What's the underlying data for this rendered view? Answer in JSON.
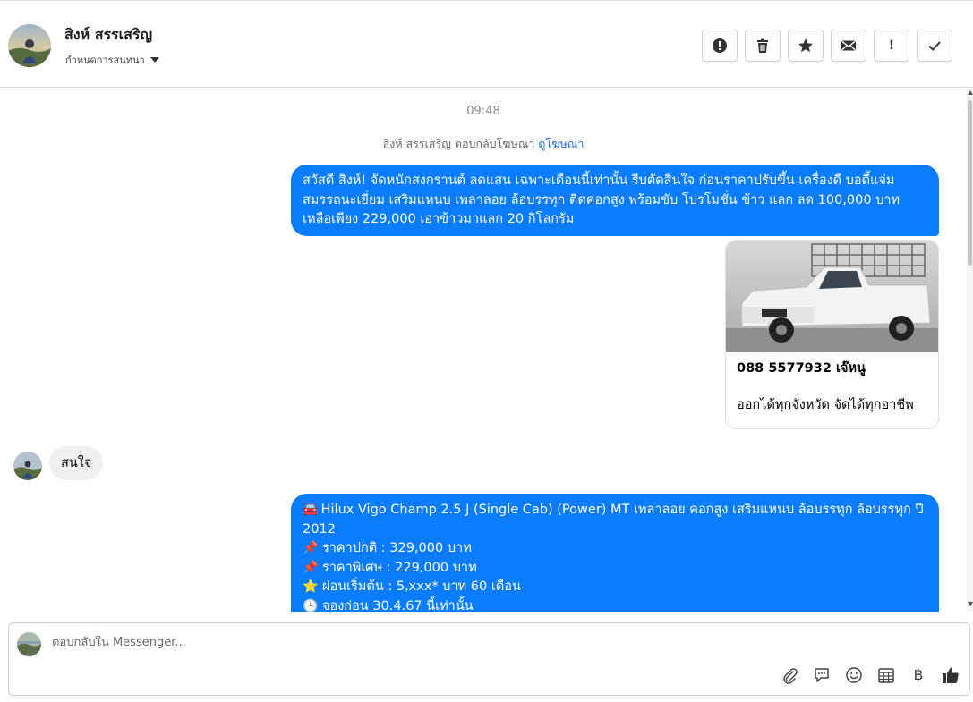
{
  "header": {
    "contact_name": "สิงห์ สรรเสริญ",
    "assign_label": "กำหนดการสนทนา",
    "actions": [
      "report-icon",
      "trash-icon",
      "star-icon",
      "envelope-icon",
      "exclamation-icon",
      "check-icon"
    ],
    "exclaim_label": "!"
  },
  "chat": {
    "timestamp": "09:48",
    "ad_reply_text": "สิงห์ สรรเสริญ ตอบกลับโฆษณา",
    "ad_reply_link": "ดูโฆษณา",
    "message1": "สวัสดี สิงห์! จัดหนักสงกรานต์ ลดแสน เฉพาะเดือนนี้เท่านั้น รีบตัดสินใจ ก่อนราคาปรับขึ้น เครื่องดี บอดี้แจ่ม สมรรถนะเยี่ยม เสริมแหนบ เพลาลอย ล้อบรรทุก ติดคอกสูง พร้อมขับ โปรโมชั่น ข้าว แลก ลด 100,000 บาท เหลือเพียง 229,000 เอาข้าวมาแลก 20 กิโลกรัม",
    "card": {
      "title": "088 5577932 เจ๊หนู",
      "description": "ออกได้ทุกจังหวัด จัดได้ทุกอาชีพ"
    },
    "incoming": "สนใจ",
    "message2": {
      "line1_emoji": "🚘",
      "line1": "Hilux Vigo Champ 2.5 J (Single Cab) (Power) MT เพลาลอย คอกสูง เสริมแหนบ ล้อบรรทุก ล้อบรรทุก ปี 2012",
      "line2_emoji": "📌",
      "line2": "ราคาปกติ : 329,000 บาท",
      "line3_emoji": "📌",
      "line3": "ราคาพิเศษ : 229,000 บาท",
      "line4_emoji": "⭐",
      "line4": "ผ่อนเริ่มต้น : 5,xxx* บาท 60 เดือน",
      "line5_emoji": "🕓",
      "line5": "จองก่อน 30.4.67 นี้เท่านั้น"
    }
  },
  "composer": {
    "placeholder": "ตอบกลับใน Messenger...",
    "tools": [
      "attachment-icon",
      "quick-reply-icon",
      "emoji-icon",
      "calendar-icon",
      "baht-icon",
      "like-icon"
    ],
    "baht_symbol": "฿"
  },
  "colors": {
    "accent": "#0a7cff",
    "incoming_bg": "#f0f0f0",
    "link": "#216fdb"
  }
}
